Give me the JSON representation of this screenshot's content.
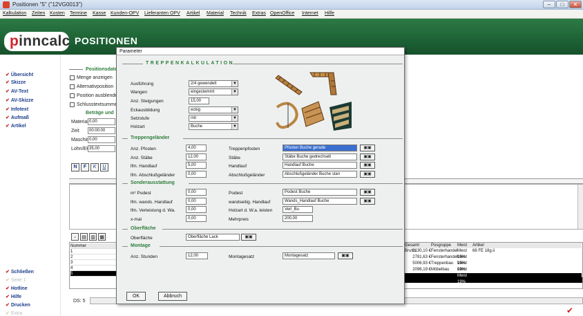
{
  "window": {
    "title": "Positionen \"5\" (\"12VG0013\")",
    "minimize": "–",
    "maximize": "□",
    "close": "✕"
  },
  "menu": [
    "Kalkulation",
    "Zeiten",
    "Kosten",
    "Termine",
    "Kasse",
    "Kunden-OPV",
    "Lieferanten OPV",
    "Artikel",
    "Material",
    "Technik",
    "Extras",
    "OpenOffice",
    "Internet",
    "Hilfe"
  ],
  "header": {
    "logo_p": "p",
    "logo_rest": "inncalc",
    "title": "POSITIONEN"
  },
  "sidebar": {
    "top_items": [
      "Übersicht",
      "Skizze",
      "AV-Text",
      "AV-Skizze",
      "Infotext",
      "Aufmaß",
      "Artikel"
    ],
    "bottom_items": [
      "Schließen",
      "Seite 1",
      "Hotline",
      "Hilfe",
      "Drucken",
      "Extra"
    ]
  },
  "background": {
    "section1": "Positionsdaten",
    "checks": [
      "Menge anzeigen",
      "Alternativposition",
      "Position ausblenden",
      "Schlusstextsumme"
    ],
    "section2": "Beträge und",
    "fields": [
      {
        "label": "Material",
        "value": "0,00"
      },
      {
        "label": "Zeit",
        "value": "00:00:00"
      },
      {
        "label": "Maschine",
        "value": "0,00"
      },
      {
        "label": "Lohn/EK",
        "value": "35,00"
      }
    ],
    "format_buttons": [
      "N",
      "F",
      "K",
      "U"
    ],
    "grid": {
      "col_left": "Nummer",
      "rows": [
        "1",
        "2",
        "3",
        "4",
        "5"
      ],
      "cols_right": [
        "Gesamt Brutto",
        "Posgruppe",
        "Mwst",
        "Artikel"
      ],
      "right_rows": [
        [
          "2130,10 €",
          "Fensterhandel",
          "Mwst 19%",
          "68 FE 18g.ii"
        ],
        [
          "2781,63 €",
          "Fensterhandel",
          "Mwst 19%",
          ""
        ],
        [
          "5006,93 €",
          "Treppenbau",
          "Mwst 19%",
          ""
        ],
        [
          "2096,19 €",
          "Möbelbau",
          "Mwst 19%",
          ""
        ],
        [
          "",
          "",
          "Mwst 19%",
          ""
        ]
      ],
      "footer_left": "DS: 5"
    }
  },
  "dialog": {
    "title": "Parameter",
    "heading": "TREPPENKALKULATION",
    "main": [
      {
        "label": "Ausführung",
        "value": "2/4 gewendelt",
        "type": "combo"
      },
      {
        "label": "Wangen",
        "value": "eingestemmt",
        "type": "combo"
      },
      {
        "label": "Anz. Steigungen",
        "value": "15,00",
        "type": "box"
      },
      {
        "label": "Eckausbildung",
        "value": "eckig",
        "type": "combo"
      },
      {
        "label": "Setzstufe",
        "value": "mit",
        "type": "combo"
      },
      {
        "label": "Holzart",
        "value": "Buche",
        "type": "combo"
      }
    ],
    "gelaender": {
      "title": "Treppengeländer",
      "rows": [
        {
          "l1": "Anz. Pfosten",
          "v1": "4,00",
          "l2": "Treppenpfosten",
          "v2": "Pfosten Buche gerade",
          "hl": true
        },
        {
          "l1": "Anz. Stäbe",
          "v1": "12,00",
          "l2": "Stäbe",
          "v2": "Stäbe Buche gedrechselt",
          "hl": false
        },
        {
          "l1": "lfm. Handlauf",
          "v1": "5,00",
          "l2": "Handlauf",
          "v2": "Handlauf Buche",
          "hl": false
        },
        {
          "l1": "lfm. Abschlußgeländer",
          "v1": "0,00",
          "l2": "Abschlußgeländer",
          "v2": "Abschlußgeländer Buche stan",
          "hl": false
        }
      ]
    },
    "sonder": {
      "title": "Sonderausstattung",
      "rows": [
        {
          "l1": "m² Podest",
          "v1": "0,00",
          "l2": "Podest",
          "v2": "Podest Buche",
          "btn": true
        },
        {
          "l1": "lfm. wands. Handlauf",
          "v1": "0,00",
          "l2": "wandseitig. Handlauf",
          "v2": "Wands_Handlauf Buche",
          "btn": true
        },
        {
          "l1": "lfm. Verleistung d. Wa.",
          "v1": "0,00",
          "l2": "Holzart d. W.a. leisten",
          "v2": "Verl_Bu",
          "btn": false
        },
        {
          "l1": "x-mal",
          "v1": "0,00",
          "l2": "Mehrpreis",
          "v2": "200,00",
          "btn": false
        }
      ]
    },
    "oberflaeche": {
      "title": "Oberfläche",
      "label": "Oberfläche",
      "value": "Oberfläche Lack"
    },
    "montage": {
      "title": "Montage",
      "l1": "Anz. Stunden",
      "v1": "12,00",
      "l2": "Montagesatz",
      "v2": "Montagesatz"
    },
    "ok": "OK",
    "cancel": "Abbruch",
    "binoc": "🔭"
  }
}
